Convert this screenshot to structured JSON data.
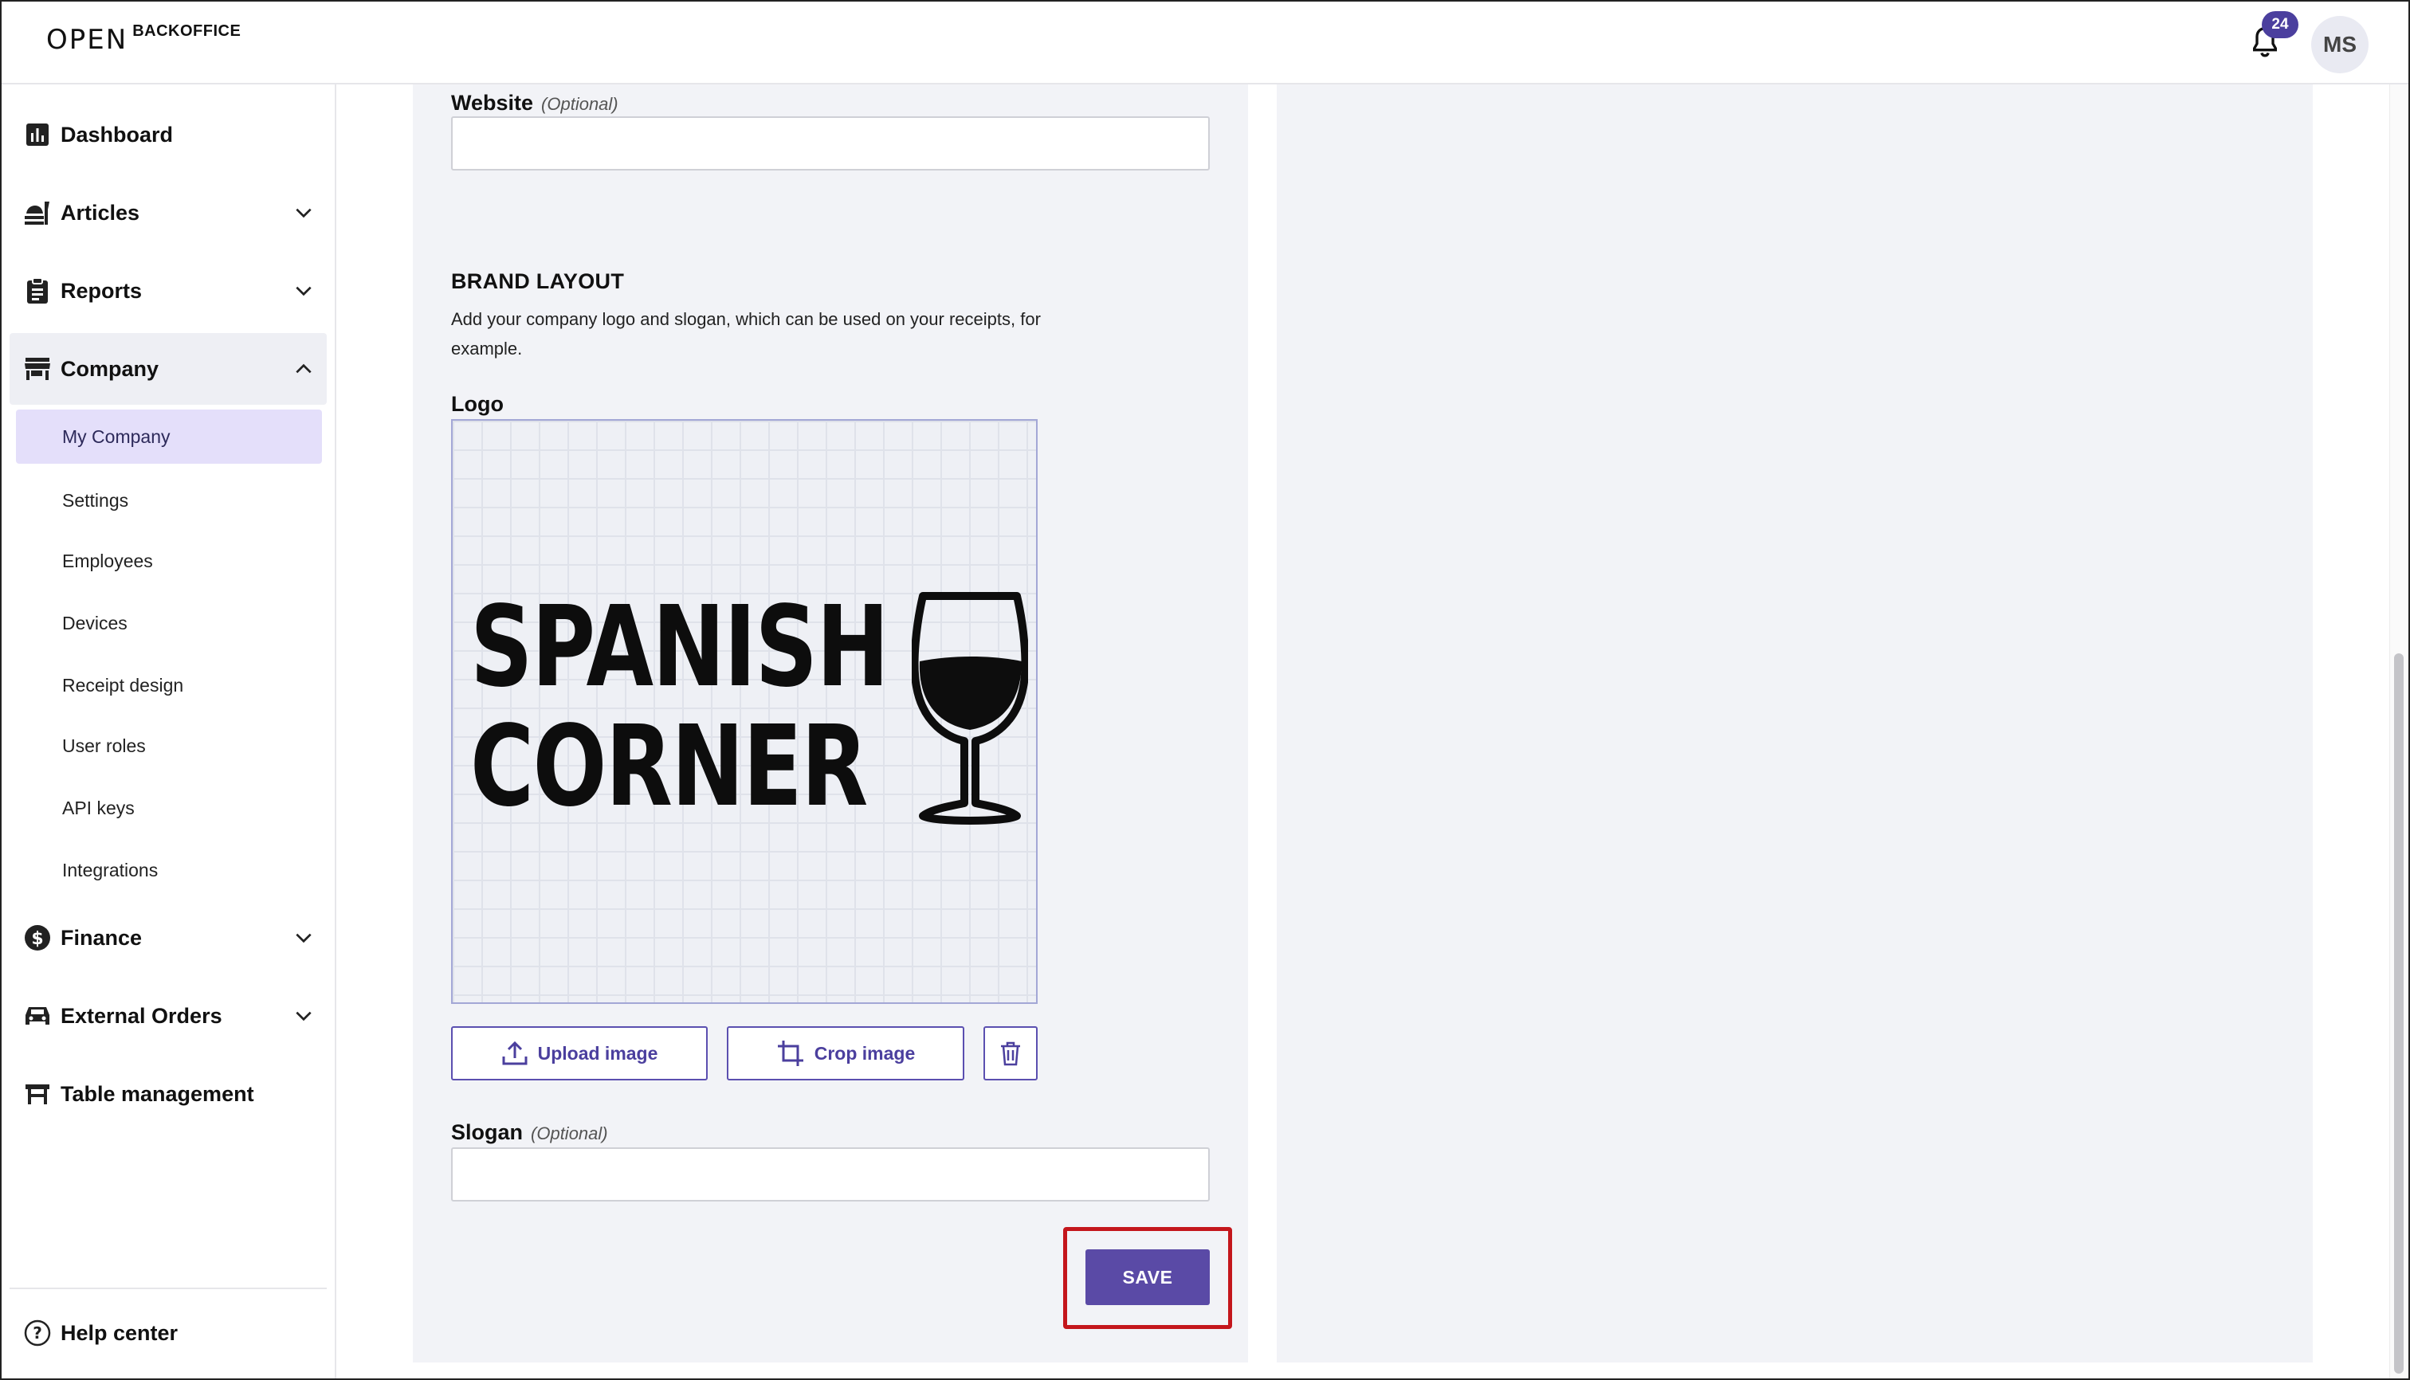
{
  "header": {
    "brand_logo": "OPEN",
    "brand_text": "BACKOFFICE",
    "notification_count": "24",
    "avatar_initials": "MS"
  },
  "sidebar": {
    "items": [
      {
        "label": "Dashboard",
        "icon": "bar-chart-icon"
      },
      {
        "label": "Articles",
        "icon": "food-icon",
        "expandable": true
      },
      {
        "label": "Reports",
        "icon": "clipboard-icon",
        "expandable": true
      },
      {
        "label": "Company",
        "icon": "store-icon",
        "expanded": true
      },
      {
        "label": "Finance",
        "icon": "dollar-icon",
        "expandable": true
      },
      {
        "label": "External Orders",
        "icon": "car-icon",
        "expandable": true
      },
      {
        "label": "Table management",
        "icon": "table-icon"
      }
    ],
    "company_subitems": [
      "My Company",
      "Settings",
      "Employees",
      "Devices",
      "Receipt design",
      "User roles",
      "API keys",
      "Integrations"
    ],
    "selected_subitem": "My Company",
    "help_label": "Help center"
  },
  "form": {
    "website_label": "Website",
    "website_optional": "(Optional)",
    "website_value": "",
    "brand_section_title": "BRAND LAYOUT",
    "brand_section_desc": "Add your company logo and slogan, which can be used on your receipts, for example.",
    "logo_label": "Logo",
    "logo_line1": "SPANISH",
    "logo_line2": "CORNER",
    "upload_label": "Upload image",
    "crop_label": "Crop image",
    "slogan_label": "Slogan",
    "slogan_optional": "(Optional)",
    "slogan_value": "",
    "save_label": "SAVE"
  },
  "colors": {
    "accent": "#5a4aa6",
    "badge": "#4b3f9e",
    "highlight": "#c4161c",
    "selected_bg": "#e4dffa"
  }
}
